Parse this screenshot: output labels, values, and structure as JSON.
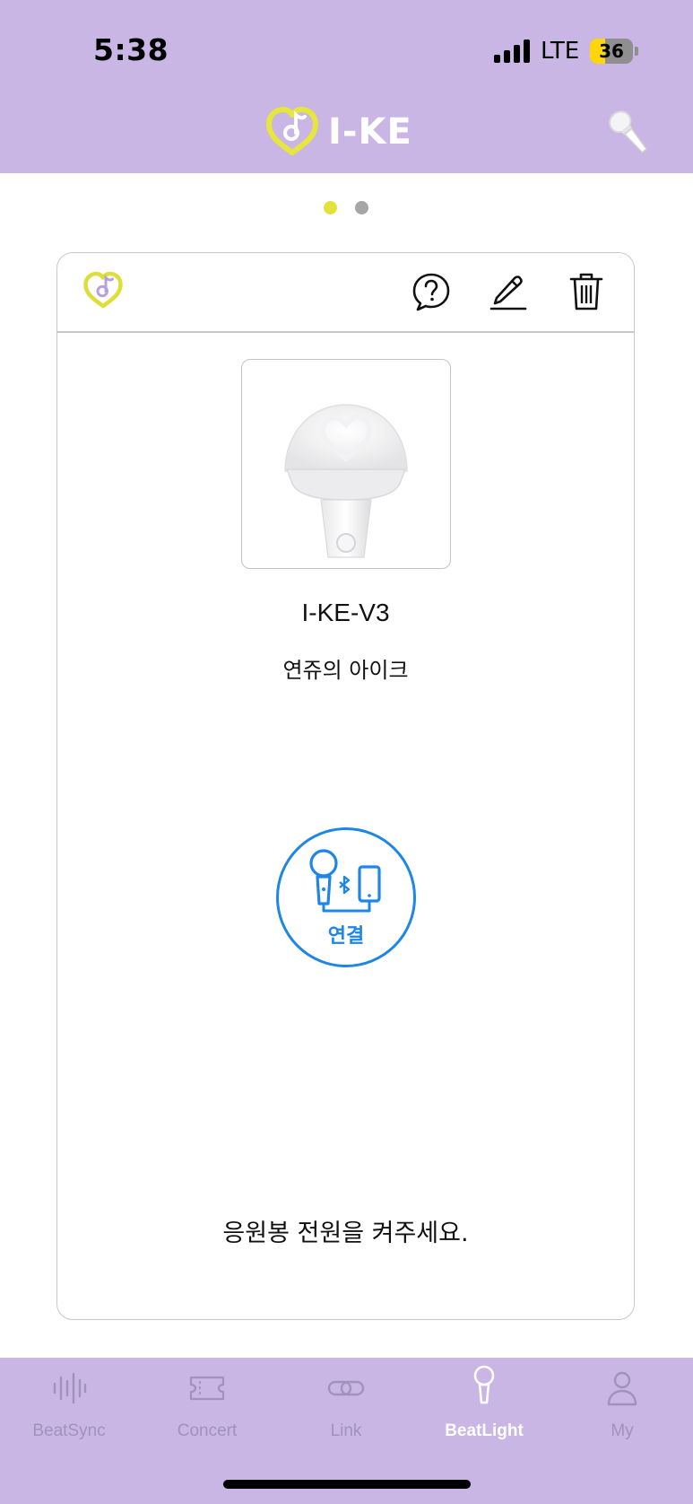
{
  "status_bar": {
    "time": "5:38",
    "network": "LTE",
    "battery_level": "36",
    "battery_fraction": 0.36,
    "signal_bars": 4
  },
  "header": {
    "brand": "I-KE",
    "logo_icon": "heart-note-logo-icon",
    "action_icon": "lightstick-icon",
    "background": "#c9b6e4"
  },
  "pager": {
    "count": 2,
    "active_index": 0,
    "active_color": "#e2e23a",
    "inactive_color": "#a6a6a6"
  },
  "card": {
    "toolbar": {
      "logo_icon": "heart-note-logo-icon",
      "help_icon": "question-bubble-icon",
      "edit_icon": "pencil-icon",
      "delete_icon": "trash-icon"
    },
    "device_name": "I-KE-V3",
    "nickname": "연쥬의 아이크",
    "connect_label": "연결",
    "connect_icon": "lightstick-bluetooth-phone-icon",
    "message": "응원봉 전원을 켜주세요."
  },
  "tabbar": {
    "items": [
      {
        "label": "BeatSync",
        "icon": "waveform-icon",
        "active": false
      },
      {
        "label": "Concert",
        "icon": "ticket-icon",
        "active": false
      },
      {
        "label": "Link",
        "icon": "link-icon",
        "active": false
      },
      {
        "label": "BeatLight",
        "icon": "lightstick-icon",
        "active": true
      },
      {
        "label": "My",
        "icon": "person-icon",
        "active": false
      }
    ]
  }
}
